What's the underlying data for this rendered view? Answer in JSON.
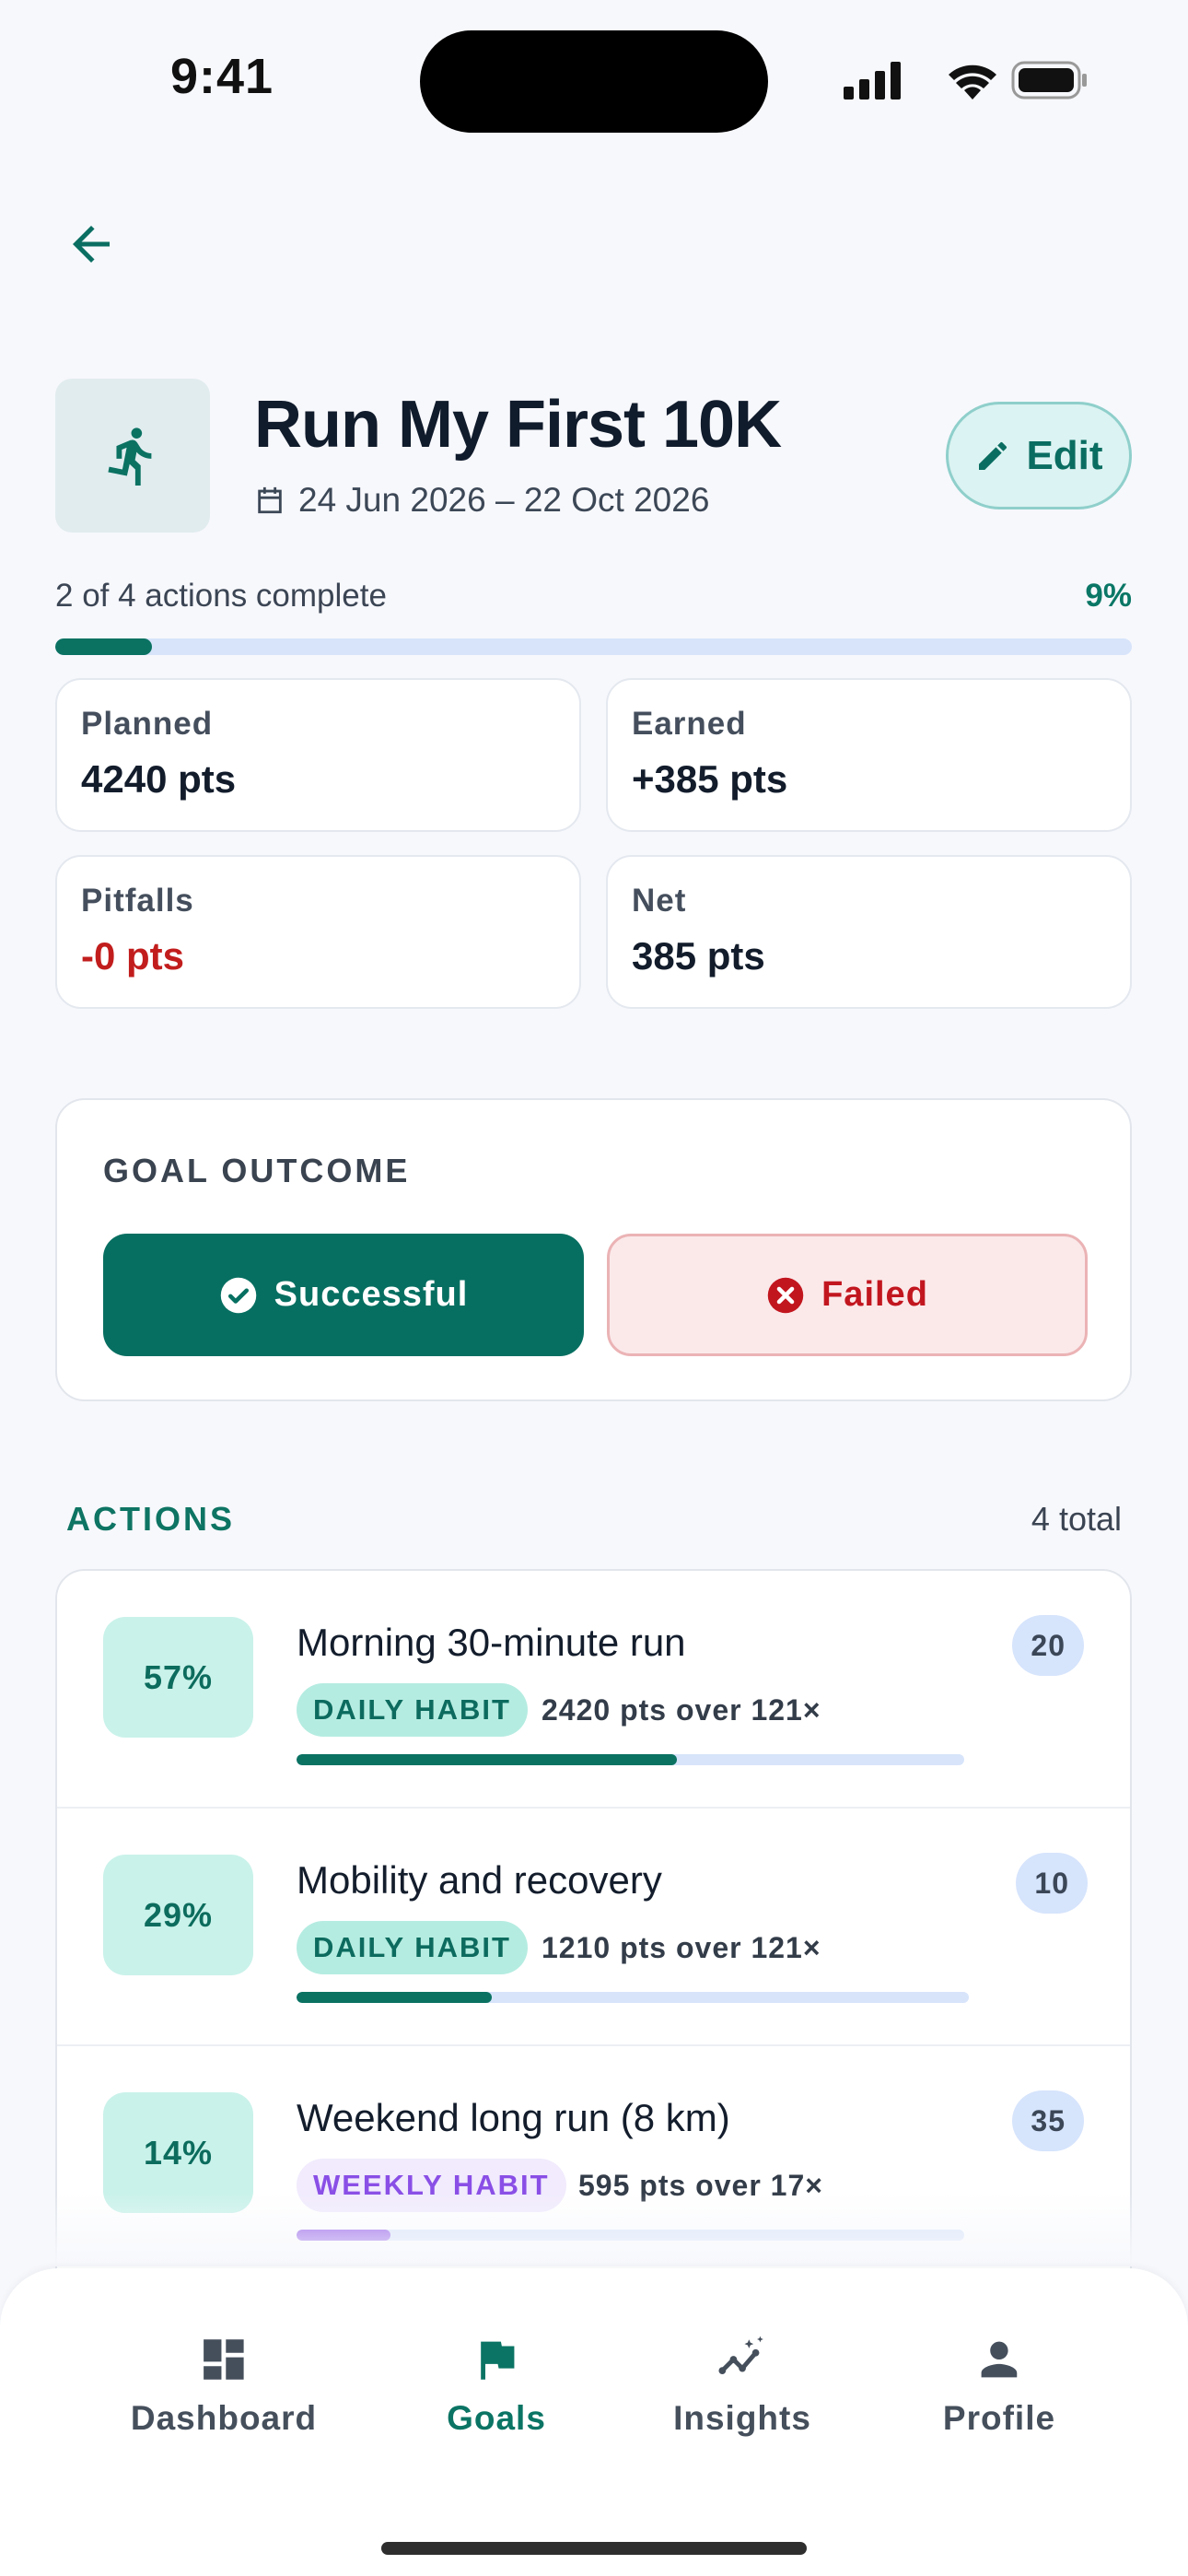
{
  "status_bar": {
    "time": "9:41"
  },
  "goal": {
    "title": "Run My First 10K",
    "dates": "24 Jun 2026 – 22 Oct 2026",
    "edit_label": "Edit",
    "icon": "running-person-icon"
  },
  "progress": {
    "label": "2 of 4 actions complete",
    "percent_label": "9%",
    "fraction": 0.09
  },
  "stats": [
    {
      "label": "Planned",
      "value": "4240 pts"
    },
    {
      "label": "Earned",
      "value": "+385 pts"
    },
    {
      "label": "Pitfalls",
      "value": "-0 pts"
    },
    {
      "label": "Net",
      "value": "385 pts"
    }
  ],
  "outcome": {
    "title": "GOAL OUTCOME",
    "success_label": "Successful",
    "failed_label": "Failed"
  },
  "actions": {
    "heading": "ACTIONS",
    "total": "4 total",
    "items": [
      {
        "percent": "57%",
        "name": "Morning 30-minute run",
        "tag": "DAILY HABIT",
        "tag_type": "daily",
        "points": "2420 pts over 121×",
        "count": "20",
        "fraction": 0.57,
        "color": "#0b7262"
      },
      {
        "percent": "29%",
        "name": "Mobility and recovery",
        "tag": "DAILY HABIT",
        "tag_type": "daily",
        "points": "1210 pts over 121×",
        "count": "10",
        "fraction": 0.29,
        "color": "#0b7262"
      },
      {
        "percent": "14%",
        "name": "Weekend long run (8 km)",
        "tag": "WEEKLY HABIT",
        "tag_type": "weekly",
        "points": "595 pts over 17×",
        "count": "35",
        "fraction": 0.14,
        "color": "#8a4fe6"
      }
    ]
  },
  "nav": {
    "items": [
      {
        "label": "Dashboard",
        "icon": "dashboard-icon"
      },
      {
        "label": "Goals",
        "icon": "flag-icon"
      },
      {
        "label": "Insights",
        "icon": "insights-icon"
      },
      {
        "label": "Profile",
        "icon": "person-icon"
      }
    ],
    "active": "Goals"
  },
  "colors": {
    "accent": "#0b7262",
    "danger": "#c2161f",
    "weekly": "#8a4fe6"
  }
}
